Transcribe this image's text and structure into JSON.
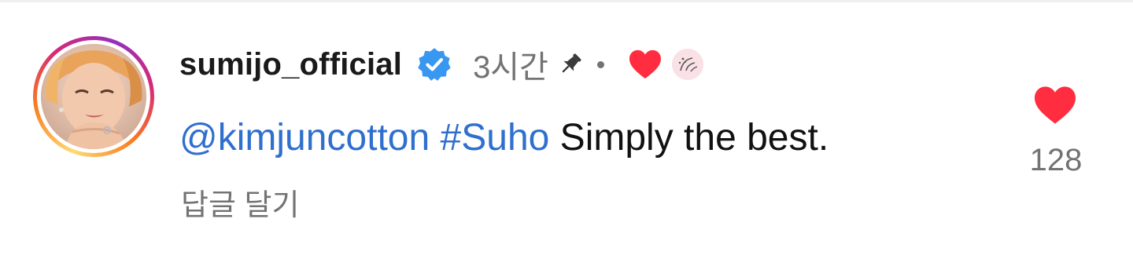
{
  "comment": {
    "username": "sumijo_official",
    "verified_icon": "verified-badge-icon",
    "time": "3시간",
    "pinned_icon": "pin-icon",
    "creator_liked_icon": "heart-icon",
    "mention": "@kimjuncotton",
    "hashtag": "#Suho",
    "text": "Simply the best.",
    "reply_label": "답글 달기",
    "like_count": "128"
  },
  "colors": {
    "link": "#2f6fce",
    "heart": "#ff2d3f",
    "verified": "#3897f0",
    "muted": "#737373"
  }
}
